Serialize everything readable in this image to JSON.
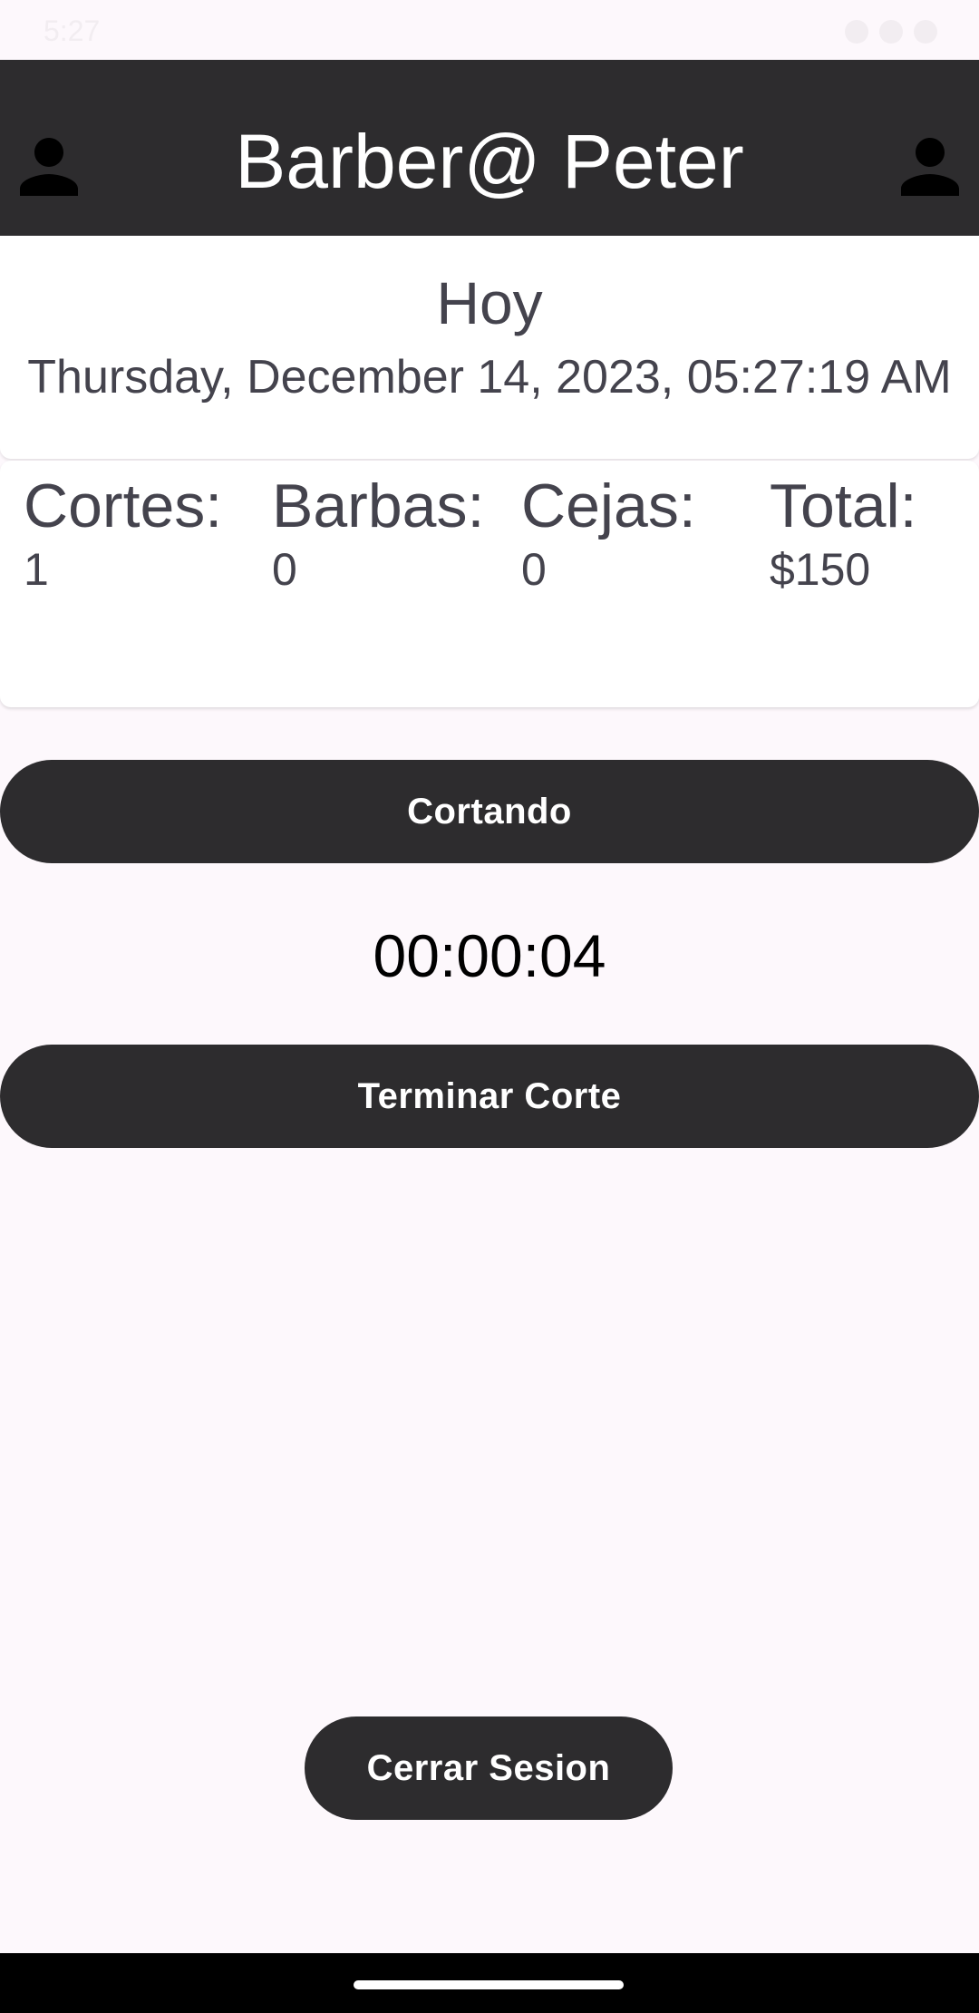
{
  "status_bar": {
    "time": "5:27"
  },
  "header": {
    "title": "Barber@ Peter",
    "left_icon": "person-icon",
    "right_icon": "person-icon"
  },
  "today": {
    "label": "Hoy",
    "date": "Thursday, December 14, 2023, 05:27:19 AM"
  },
  "stats": [
    {
      "label": "Cortes:",
      "value": "1"
    },
    {
      "label": "Barbas:",
      "value": "0"
    },
    {
      "label": "Cejas:",
      "value": "0"
    },
    {
      "label": "Total:",
      "value": "$150"
    }
  ],
  "actions": {
    "cortando_label": "Cortando",
    "timer": "00:00:04",
    "terminar_label": "Terminar Corte",
    "logout_label": "Cerrar Sesion"
  },
  "colors": {
    "app_bar": "#2d2c2e",
    "button": "#2d2c2e",
    "background": "#fdf8fc",
    "text_muted": "#44434d"
  }
}
